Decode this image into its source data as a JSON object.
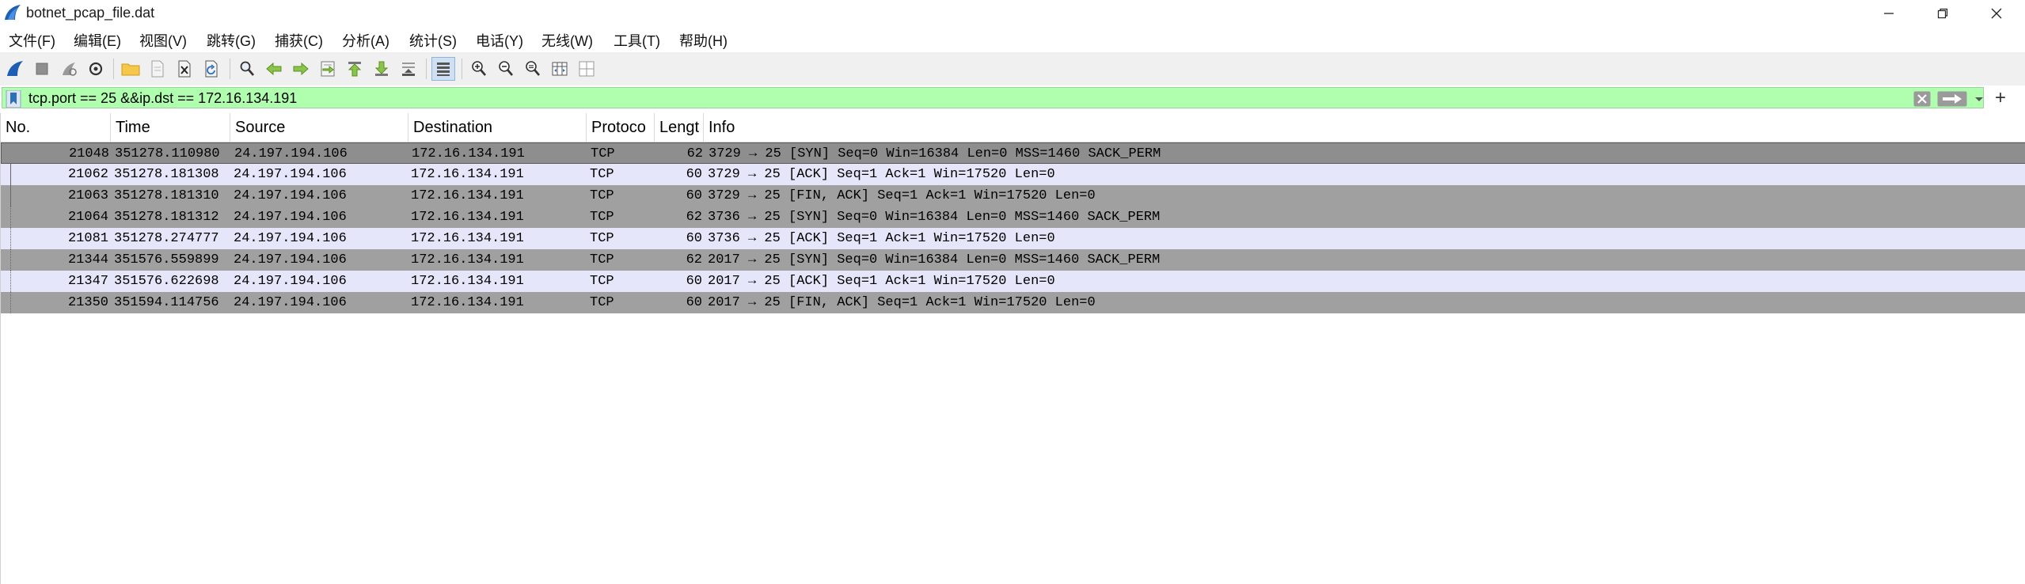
{
  "window": {
    "title": "botnet_pcap_file.dat",
    "controls": [
      "minimize",
      "restore",
      "close"
    ]
  },
  "menu": [
    "文件(F)",
    "编辑(E)",
    "视图(V)",
    "跳转(G)",
    "捕获(C)",
    "分析(A)",
    "统计(S)",
    "电话(Y)",
    "无线(W)",
    "工具(T)",
    "帮助(H)"
  ],
  "toolbar": {
    "icons": [
      "shark-fin-start-icon",
      "stop-capture-icon",
      "restart-capture-icon",
      "capture-options-icon",
      "open-file-icon",
      "save-file-icon",
      "close-file-icon",
      "reload-file-icon",
      "find-packet-icon",
      "go-back-icon",
      "go-forward-icon",
      "go-to-packet-icon",
      "go-first-icon",
      "go-last-icon",
      "autoscroll-icon",
      "colorize-icon",
      "zoom-in-icon",
      "zoom-out-icon",
      "zoom-normal-icon",
      "resize-columns-icon",
      "layout-icon"
    ]
  },
  "filter": {
    "value": "tcp.port == 25 &&ip.dst == 172.16.134.191",
    "background": "#afffaf",
    "add_label": "+"
  },
  "columns": [
    "No.",
    "Time",
    "Source",
    "Destination",
    "Protoco",
    "Lengt",
    "Info"
  ],
  "colors": {
    "row_dark": "#a0a0a0",
    "row_light": "#e6e6fa",
    "row_selected": "#8e8e8e"
  },
  "packets": [
    {
      "no": "21048",
      "time": "351278.110980",
      "src": "24.197.194.106",
      "dst": "172.16.134.191",
      "proto": "TCP",
      "len": "62",
      "info": "3729 → 25 [SYN] Seq=0 Win=16384 Len=0 MSS=1460 SACK_PERM",
      "style": "selected"
    },
    {
      "no": "21062",
      "time": "351278.181308",
      "src": "24.197.194.106",
      "dst": "172.16.134.191",
      "proto": "TCP",
      "len": "60",
      "info": "3729 → 25 [ACK] Seq=1 Ack=1 Win=17520 Len=0",
      "style": "light"
    },
    {
      "no": "21063",
      "time": "351278.181310",
      "src": "24.197.194.106",
      "dst": "172.16.134.191",
      "proto": "TCP",
      "len": "60",
      "info": "3729 → 25 [FIN, ACK] Seq=1 Ack=1 Win=17520 Len=0",
      "style": "dark"
    },
    {
      "no": "21064",
      "time": "351278.181312",
      "src": "24.197.194.106",
      "dst": "172.16.134.191",
      "proto": "TCP",
      "len": "62",
      "info": "3736 → 25 [SYN] Seq=0 Win=16384 Len=0 MSS=1460 SACK_PERM",
      "style": "dark"
    },
    {
      "no": "21081",
      "time": "351278.274777",
      "src": "24.197.194.106",
      "dst": "172.16.134.191",
      "proto": "TCP",
      "len": "60",
      "info": "3736 → 25 [ACK] Seq=1 Ack=1 Win=17520 Len=0",
      "style": "light"
    },
    {
      "no": "21344",
      "time": "351576.559899",
      "src": "24.197.194.106",
      "dst": "172.16.134.191",
      "proto": "TCP",
      "len": "62",
      "info": "2017 → 25 [SYN] Seq=0 Win=16384 Len=0 MSS=1460 SACK_PERM",
      "style": "dark"
    },
    {
      "no": "21347",
      "time": "351576.622698",
      "src": "24.197.194.106",
      "dst": "172.16.134.191",
      "proto": "TCP",
      "len": "60",
      "info": "2017 → 25 [ACK] Seq=1 Ack=1 Win=17520 Len=0",
      "style": "light"
    },
    {
      "no": "21350",
      "time": "351594.114756",
      "src": "24.197.194.106",
      "dst": "172.16.134.191",
      "proto": "TCP",
      "len": "60",
      "info": "2017 → 25 [FIN, ACK] Seq=1 Ack=1 Win=17520 Len=0",
      "style": "dark"
    }
  ]
}
